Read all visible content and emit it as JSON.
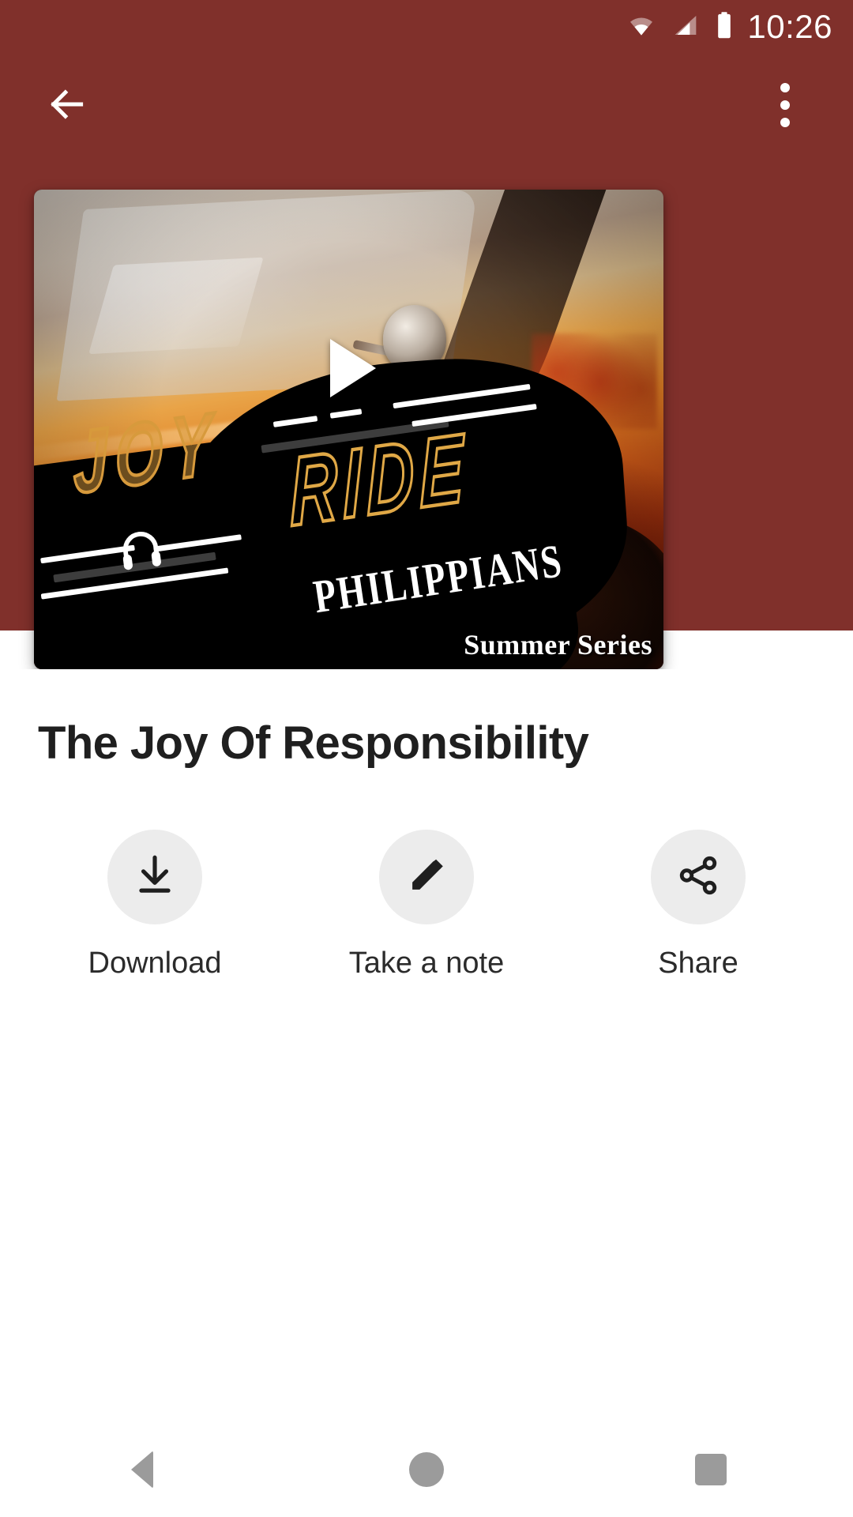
{
  "status_bar": {
    "time": "10:26",
    "icons": [
      "wifi-icon",
      "cellular-signal-icon",
      "battery-icon"
    ],
    "background_color": "#80302b"
  },
  "app_bar": {
    "back_icon": "back-arrow-icon",
    "overflow_icon": "more-vertical-icon",
    "background_color": "#80302b"
  },
  "media_card": {
    "series_label": "Summer Series",
    "artwork_title_line1": "JOY",
    "artwork_title_line2": "RIDE",
    "artwork_subtitle": "PHILIPPIANS",
    "play_icon": "play-icon",
    "headphones_icon": "headphones-icon",
    "accent_color": "#e0a846"
  },
  "episode": {
    "title": "The Joy Of Responsibility"
  },
  "actions": [
    {
      "id": "download",
      "label": "Download",
      "icon": "download-icon"
    },
    {
      "id": "take-a-note",
      "label": "Take a note",
      "icon": "pencil-icon"
    },
    {
      "id": "share",
      "label": "Share",
      "icon": "share-icon"
    }
  ],
  "nav_bar": {
    "back_label": "Back",
    "home_label": "Home",
    "recents_label": "Recents",
    "icon_color": "#9b9b9b"
  }
}
